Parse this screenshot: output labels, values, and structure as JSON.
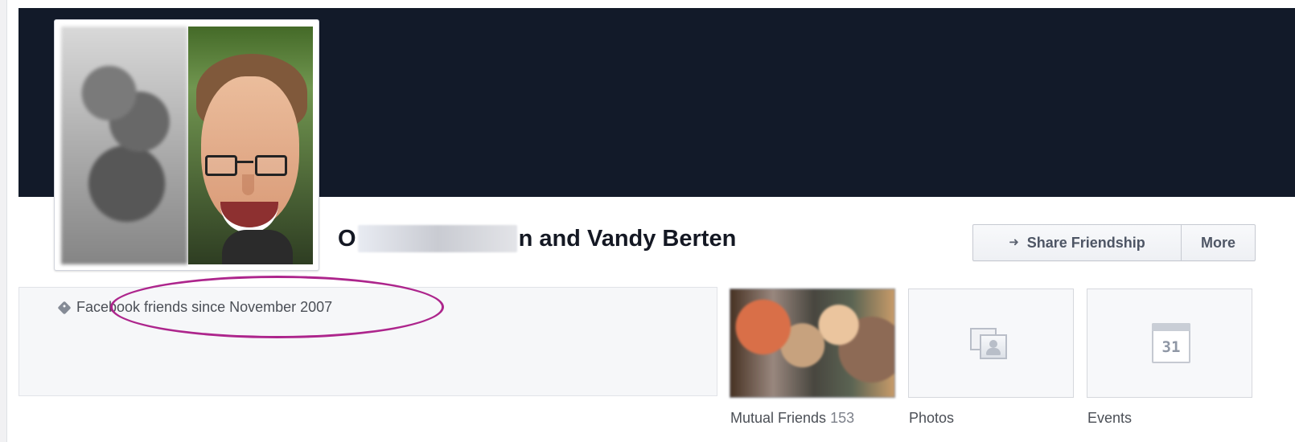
{
  "profile": {
    "title_prefix": "O",
    "title_suffix": "n and Vandy Berten"
  },
  "actions": {
    "share_label": "Share Friendship",
    "more_label": "More",
    "share_icon": "share-arrow-icon"
  },
  "friendship_info": {
    "text": "Facebook friends since November 2007",
    "icon": "tag-icon"
  },
  "tiles": {
    "mutual_friends": {
      "label": "Mutual Friends",
      "count": "153"
    },
    "photos": {
      "label": "Photos",
      "icon": "photos-icon"
    },
    "events": {
      "label": "Events",
      "icon": "calendar-icon",
      "calendar_number": "31"
    }
  },
  "colors": {
    "cover": "#121a29",
    "annotation": "#ad258c",
    "text": "#141823",
    "secondary_text": "#4b4f56"
  }
}
